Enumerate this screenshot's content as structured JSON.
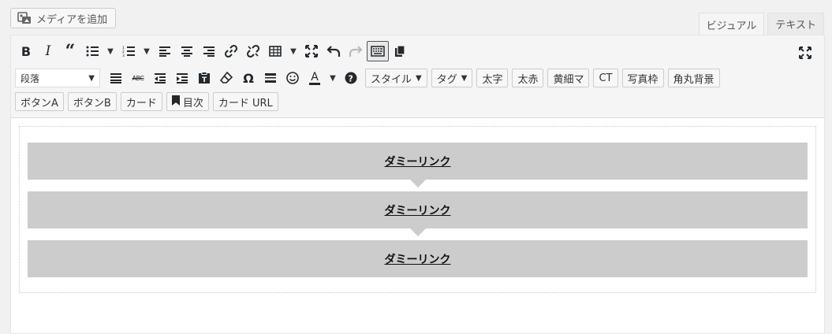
{
  "media_button": {
    "label": "メディアを追加",
    "icon": "media-add-icon"
  },
  "tabs": [
    {
      "label": "ビジュアル",
      "active": true
    },
    {
      "label": "テキスト",
      "active": false
    }
  ],
  "toolbar": {
    "row1_icons": [
      "bold-icon",
      "italic-icon",
      "blockquote-icon",
      "bullet-list-icon",
      "numbered-list-icon",
      "align-left-icon",
      "align-center-icon",
      "align-right-icon",
      "link-icon",
      "unlink-icon",
      "table-icon",
      "fullscreen-icon",
      "undo-icon",
      "redo-icon",
      "toolbar-toggle-icon",
      "copy-icon"
    ],
    "format_select": "段落",
    "row2_icons": [
      "justify-icon",
      "strikethrough-icon",
      "outdent-icon",
      "indent-icon",
      "paste-text-icon",
      "clear-format-icon",
      "special-char-icon",
      "horizontal-line-icon",
      "emoji-icon",
      "text-color-icon",
      "help-icon"
    ],
    "strike_glyph": "ABC",
    "omega_glyph": "Ω",
    "color_glyph": "A",
    "style_dropdown": "スタイル",
    "tag_dropdown": "タグ",
    "row2_buttons": [
      "太字",
      "太赤",
      "黄細マ",
      "CT",
      "写真枠",
      "角丸背景"
    ],
    "row3_buttons": [
      "ボタンA",
      "ボタンB",
      "カード"
    ],
    "toc_button": "目次",
    "card_url_button": "カード URL"
  },
  "content": {
    "links": [
      {
        "text": "ダミーリンク"
      },
      {
        "text": "ダミーリンク"
      },
      {
        "text": "ダミーリンク"
      }
    ]
  },
  "colors": {
    "link_box_bg": "#cccccc",
    "toolbar_bg": "#f5f5f5",
    "page_bg": "#f1f1f1"
  }
}
